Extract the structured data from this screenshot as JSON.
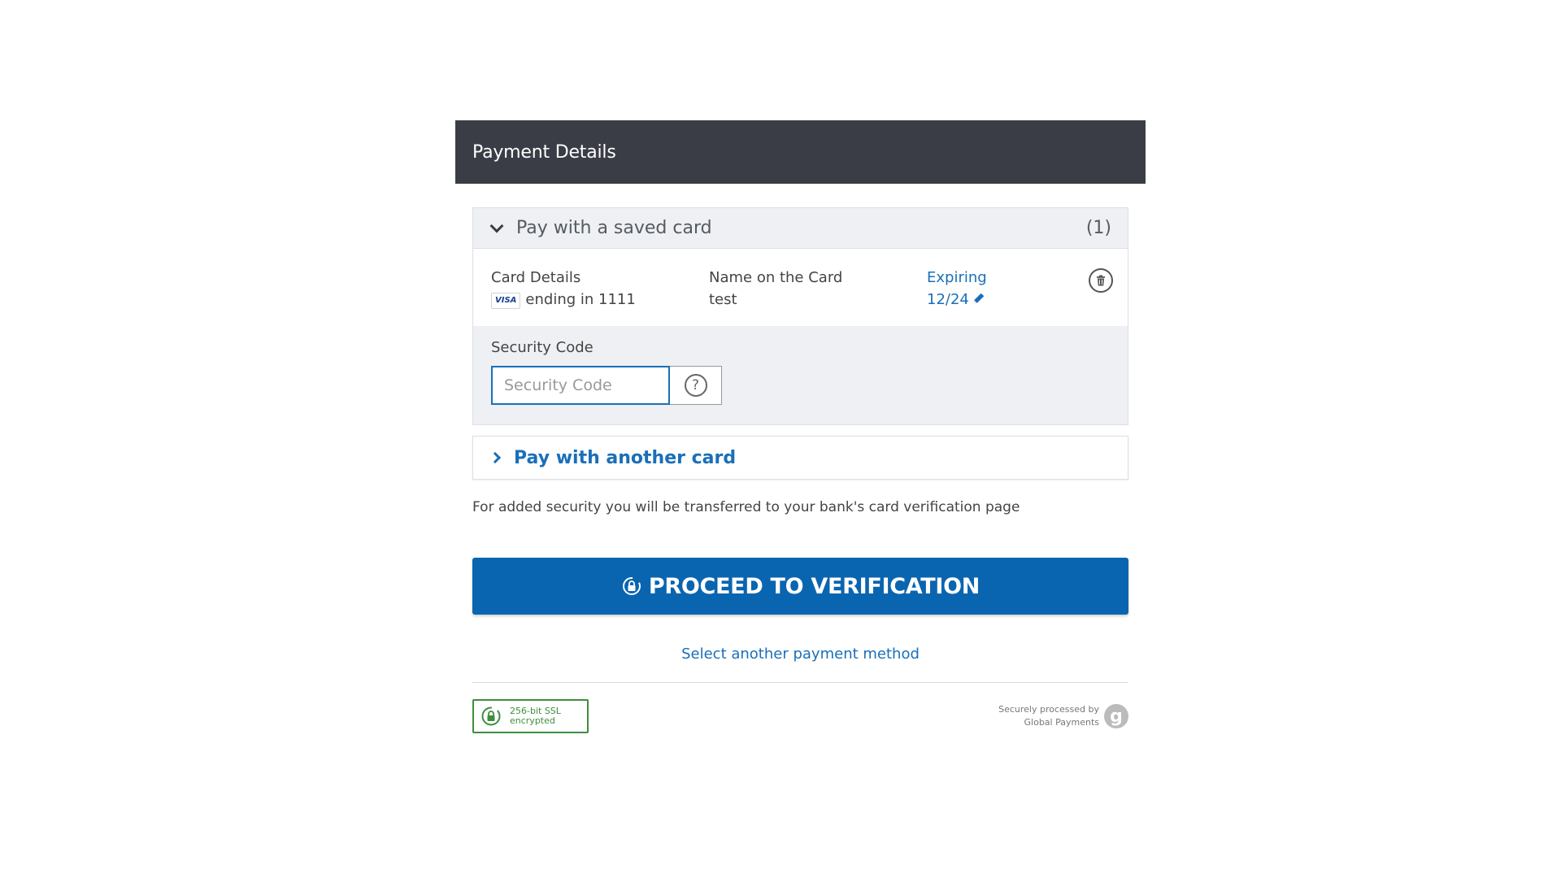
{
  "header": {
    "title": "Payment Details"
  },
  "saved_card": {
    "title": "Pay with a saved card",
    "count": "(1)",
    "details_label": "Card Details",
    "brand": "VISA",
    "ending": "ending in 1111",
    "name_label": "Name on the Card",
    "name_value": "test",
    "expiring_label": "Expiring",
    "expiring_value": "12/24",
    "security_label": "Security Code",
    "security_placeholder": "Security Code",
    "help_glyph": "?"
  },
  "another_card": {
    "label": "Pay with another card"
  },
  "info_text": "For added security you will be transferred to your bank's card verification page",
  "proceed_button": {
    "label": "PROCEED TO VERIFICATION"
  },
  "another_method_link": "Select another payment method",
  "footer": {
    "ssl_line1": "256-bit SSL",
    "ssl_line2": "encrypted",
    "processed_line1": "Securely processed by",
    "processed_line2": "Global Payments",
    "logo_glyph": "g"
  },
  "colors": {
    "header_bg": "#3a3d45",
    "accent": "#0a65b0",
    "link": "#1a6fb8",
    "ssl_green": "#3e8e3e"
  },
  "icons": {
    "chevron_down": "chevron-down-icon",
    "chevron_right": "chevron-right-icon",
    "trash": "trash-icon",
    "pencil": "pencil-icon",
    "help": "help-icon",
    "lock": "lock-icon",
    "global_payments_logo": "global-payments-logo"
  }
}
